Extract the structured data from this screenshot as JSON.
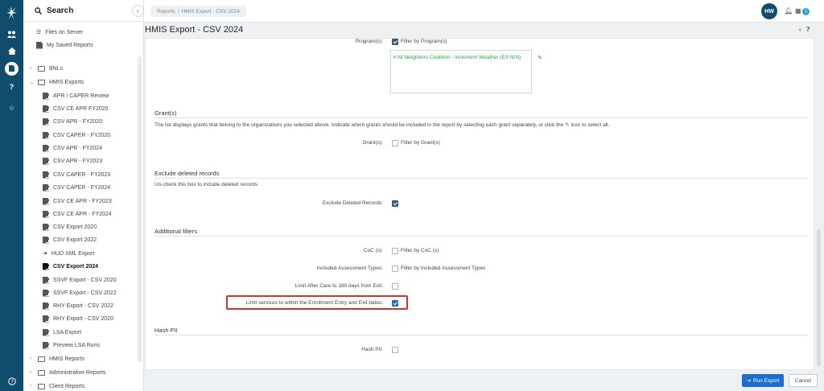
{
  "sidebar": {
    "search_label": "Search",
    "items": [
      {
        "label": "Files on Server",
        "icon": "list-icon",
        "kind": "list",
        "indent": 1
      },
      {
        "label": "My Saved Reports",
        "icon": "saved-reports-icon",
        "kind": "doc",
        "indent": 1
      },
      {
        "label": "BNLs",
        "icon": "folder-icon",
        "kind": "folder",
        "caret": "›",
        "indent": 0
      },
      {
        "label": "HMIS Exports",
        "icon": "folder-icon",
        "kind": "folder",
        "caret": "⌄",
        "indent": 0
      },
      {
        "label": "APR / CAPER Review",
        "kind": "doc",
        "indent": 2
      },
      {
        "label": "CSV CE APR FY2020",
        "kind": "doc",
        "indent": 2
      },
      {
        "label": "CSV APR - FY2020",
        "kind": "doc",
        "indent": 2
      },
      {
        "label": "CSV CAPER - FY2020",
        "kind": "doc",
        "indent": 2
      },
      {
        "label": "CSV APR - FY2024",
        "kind": "doc",
        "indent": 2
      },
      {
        "label": "CSV APR - FY2023",
        "kind": "doc",
        "indent": 2
      },
      {
        "label": "CSV CAPER - FY2023",
        "kind": "doc",
        "indent": 2
      },
      {
        "label": "CSV CAPER - FY2024",
        "kind": "doc",
        "indent": 2
      },
      {
        "label": "CSV CE APR - FY2023",
        "kind": "doc",
        "indent": 2
      },
      {
        "label": "CSV CE APR - FY2024",
        "kind": "doc",
        "indent": 2
      },
      {
        "label": "CSV Export 2020",
        "kind": "doc",
        "indent": 2
      },
      {
        "label": "CSV Export 2022",
        "kind": "doc",
        "indent": 2
      },
      {
        "label": "HUD XML Export",
        "kind": "arrow",
        "indent": 2
      },
      {
        "label": "CSV Export 2024",
        "kind": "doc",
        "indent": 2,
        "active": true
      },
      {
        "label": "SSVF Export - CSV 2020",
        "kind": "doc",
        "indent": 2
      },
      {
        "label": "SSVF Export - CSV 2022",
        "kind": "doc",
        "indent": 2
      },
      {
        "label": "RHY Export - CSV 2022",
        "kind": "doc",
        "indent": 2
      },
      {
        "label": "RHY Export - CSV 2020",
        "kind": "doc",
        "indent": 2
      },
      {
        "label": "LSA Export",
        "kind": "doc",
        "indent": 2
      },
      {
        "label": "Preview LSA Runs",
        "kind": "doc",
        "indent": 2
      },
      {
        "label": "HMIS Reports",
        "icon": "folder-icon",
        "kind": "folder",
        "caret": "›",
        "indent": 0
      },
      {
        "label": "Administrative Reports",
        "icon": "folder-icon",
        "kind": "folder",
        "caret": "›",
        "indent": 0
      },
      {
        "label": "Client Reports",
        "icon": "folder-icon",
        "kind": "folder",
        "caret": "›",
        "indent": 0
      }
    ]
  },
  "topbar": {
    "breadcrumb_root": "Reports",
    "breadcrumb_sep": "/",
    "breadcrumb_current": "HMIS Export - CSV 2024",
    "avatar_initials": "HW",
    "badge_count": "2"
  },
  "page": {
    "title": "HMIS Export - CSV 2024"
  },
  "form": {
    "programs_label": "Program(s):",
    "programs_filter_text": "Filter by Program(s)",
    "programs_selected": "All Neighbors Coalition - Inclement Weather (ES N/N)",
    "grants_section": "Grant(s)",
    "grants_desc_pre": "The list displays grants that belong to the organizations you selected above. Indicate which grants should be included in the report by selecting each grant separately, or click the",
    "grants_desc_post": "icon to select all.",
    "grants_label": "Grant(s):",
    "grants_filter_text": "Filter by Grant(s)",
    "exclude_section": "Exclude deleted records",
    "exclude_desc": "Un-check this box to include deleted records.",
    "exclude_label": "Exclude Deleted Records:",
    "additional_section": "Additional filters",
    "coc_label": "CoC (s):",
    "coc_filter_text": "Filter by CoC (s)",
    "assessment_label": "Included Assessment Types:",
    "assessment_filter_text": "Filter by Included Assessment Types",
    "aftercare_label": "Limit After Care to 180 days from Exit:",
    "limit_services_label": "Limit services to within the Enrollment Entry and Exit dates:",
    "hash_section": "Hash PII",
    "hash_label": "Hash PII:"
  },
  "footer": {
    "run_label": "Run Export",
    "cancel_label": "Cancel"
  },
  "colors": {
    "rail": "#0f4c6e",
    "primary_button": "#1c6fd1",
    "highlight_border": "#d63031",
    "selected_program": "#2aa84a"
  }
}
